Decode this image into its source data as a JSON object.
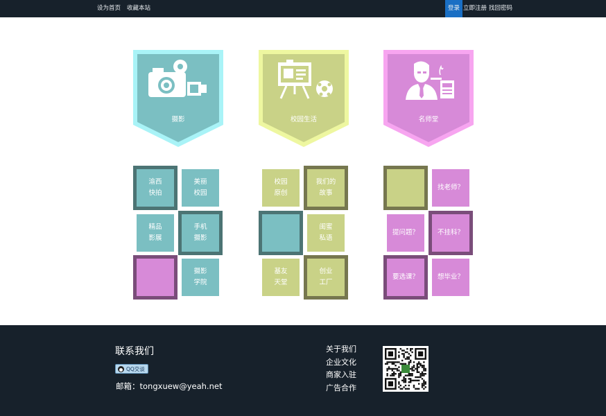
{
  "topbar": {
    "set_home": "设为首页",
    "bookmark": "收藏本站",
    "login": "登录",
    "register": "立即注册",
    "recover_password": "找回密码"
  },
  "categories": [
    {
      "label": "摄影",
      "color": "#7bbfc2",
      "border": "#a9f3f7",
      "icon": "camera-icon"
    },
    {
      "label": "校园生活",
      "color": "#c9d287",
      "border": "#eef7a0",
      "icon": "presentation-board-icon"
    },
    {
      "label": "名师堂",
      "color": "#d78ad8",
      "border": "#f7a5f0",
      "icon": "teacher-icon"
    }
  ],
  "photography_tiles": {
    "t1": "渝西\n快拍",
    "t2": "美丽\n校园",
    "t3": "精品\n影展",
    "t4": "手机\n摄影",
    "t6": "摄影\n学院"
  },
  "campus_tiles": {
    "t1": "校园\n原创",
    "t2": "我们的\n故事",
    "t4": "闺蜜\n私语",
    "t5": "基友\n天堂",
    "t6": "创业\n工厂"
  },
  "teacher_tiles": {
    "t2": "找老师？",
    "t3": "提问题？",
    "t4": "不挂科？",
    "t5": "要选课？",
    "t6": "想毕业？"
  },
  "colors": {
    "teal": "#7bbfc2",
    "lime": "#c9d287",
    "purple": "#d78ad8",
    "dark_teal": "#4c7474",
    "dark_olive": "#76774f",
    "dark_purple": "#7a4d7a",
    "footer": "#17212b",
    "login_bg": "#1a6fc4"
  },
  "footer": {
    "contact_title": "联系我们",
    "qq_button": "QQ交谈",
    "email": "邮箱：tongxuew@yeah.net",
    "links": [
      "关于我们",
      "企业文化",
      "商家入驻",
      "广告合作"
    ]
  }
}
